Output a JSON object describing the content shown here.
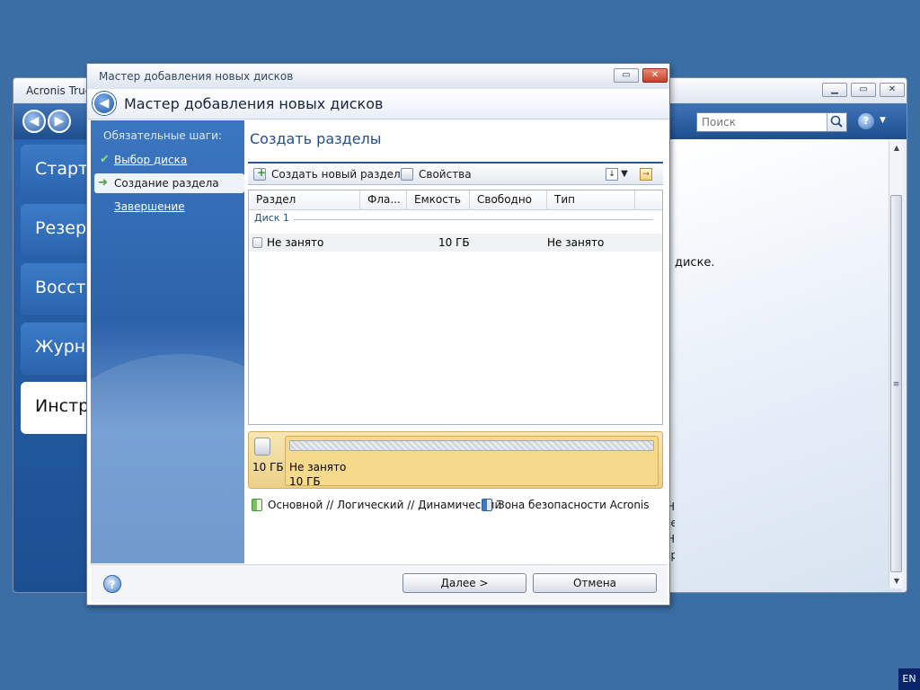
{
  "background_window": {
    "title": "Acronis True",
    "search": {
      "placeholder": "Поиск"
    },
    "sidebar": {
      "items": [
        {
          "label": "Стартов"
        },
        {
          "label": "Резерв"
        },
        {
          "label": "Восстан"
        },
        {
          "label": "Журна"
        },
        {
          "label": "Инстру"
        }
      ]
    },
    "content_text": "диске.",
    "partial_text": [
      "Н",
      "пре,",
      "Н",
      "церх"
    ]
  },
  "wizard": {
    "window_title": "Мастер добавления новых дисков",
    "heading": "Мастер добавления новых дисков",
    "steps": {
      "caption": "Обязательные шаги:",
      "items": [
        {
          "label": "Выбор диска",
          "state": "done"
        },
        {
          "label": "Создание раздела",
          "state": "current"
        },
        {
          "label": "Завершение",
          "state": "pending"
        }
      ]
    },
    "section_title": "Создать разделы",
    "toolbar": {
      "create_label": "Создать новый раздел",
      "properties_label": "Свойства"
    },
    "table": {
      "columns": [
        "Раздел",
        "Фла...",
        "Емкость",
        "Свободно",
        "Тип"
      ],
      "group": "Диск 1",
      "rows": [
        {
          "partition": "Не занято",
          "flags": "",
          "capacity": "10 ГБ",
          "free": "",
          "type": "Не занято"
        }
      ]
    },
    "disk_map": {
      "disk_size": "10 ГБ",
      "partition_label": "Не занято",
      "partition_size": "10 ГБ"
    },
    "legend": {
      "primary": "Основной // Логический // Динамический",
      "secure_zone": "Зона безопасности Acronis"
    },
    "buttons": {
      "next": "Далее >",
      "cancel": "Отмена"
    }
  },
  "taskbar": {
    "language": "EN"
  },
  "colors": {
    "desktop": "#3a6ea5",
    "accent": "#214f8c",
    "unallocated": "#f7d98c"
  }
}
